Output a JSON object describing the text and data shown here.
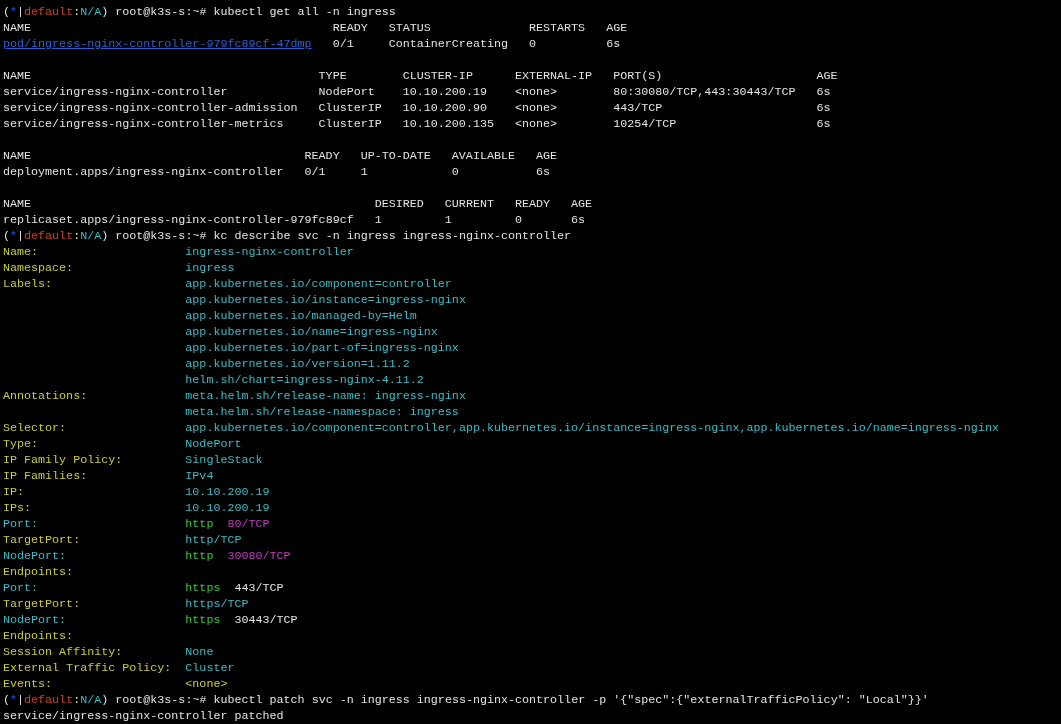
{
  "terminal": {
    "blocks": [
      {
        "kind": "prompt",
        "segments": [
          {
            "text": "(",
            "kind": "plain"
          },
          {
            "text": "*",
            "kind": "star"
          },
          {
            "text": "|",
            "kind": "plain"
          },
          {
            "text": "default",
            "kind": "context"
          },
          {
            "text": ":",
            "kind": "plain"
          },
          {
            "text": "N/A",
            "kind": "namespace"
          },
          {
            "text": ") root@k3s-s:~#",
            "kind": "plain"
          }
        ],
        "command": "kubectl get all -n ingress"
      },
      {
        "kind": "table",
        "header": [
          "NAME",
          "READY",
          "STATUS",
          "RESTARTS",
          "AGE"
        ],
        "rows": [
          {
            "linked": true,
            "cells": [
              "pod/ingress-nginx-controller-979fc89cf-47dmp",
              "0/1",
              "ContainerCreating",
              "0",
              "6s"
            ]
          }
        ]
      },
      {
        "kind": "table",
        "header": [
          "NAME",
          "TYPE",
          "CLUSTER-IP",
          "EXTERNAL-IP",
          "PORT(S)",
          "AGE"
        ],
        "rows": [
          {
            "linked": false,
            "cells": [
              "service/ingress-nginx-controller",
              "NodePort",
              "10.10.200.19",
              "<none>",
              "80:30080/TCP,443:30443/TCP",
              "6s"
            ]
          },
          {
            "linked": false,
            "cells": [
              "service/ingress-nginx-controller-admission",
              "ClusterIP",
              "10.10.200.90",
              "<none>",
              "443/TCP",
              "6s"
            ]
          },
          {
            "linked": false,
            "cells": [
              "service/ingress-nginx-controller-metrics",
              "ClusterIP",
              "10.10.200.135",
              "<none>",
              "10254/TCP",
              "6s"
            ]
          }
        ]
      },
      {
        "kind": "table",
        "header": [
          "NAME",
          "READY",
          "UP-TO-DATE",
          "AVAILABLE",
          "AGE"
        ],
        "rows": [
          {
            "linked": false,
            "cells": [
              "deployment.apps/ingress-nginx-controller",
              "0/1",
              "1",
              "0",
              "6s"
            ]
          }
        ]
      },
      {
        "kind": "table",
        "header": [
          "NAME",
          "DESIRED",
          "CURRENT",
          "READY",
          "AGE"
        ],
        "rows": [
          {
            "linked": false,
            "cells": [
              "replicaset.apps/ingress-nginx-controller-979fc89cf",
              "1",
              "1",
              "0",
              "6s"
            ]
          }
        ]
      },
      {
        "kind": "prompt",
        "segments": [
          {
            "text": "(",
            "kind": "plain"
          },
          {
            "text": "*",
            "kind": "star"
          },
          {
            "text": "|",
            "kind": "plain"
          },
          {
            "text": "default",
            "kind": "context"
          },
          {
            "text": ":",
            "kind": "plain"
          },
          {
            "text": "N/A",
            "kind": "namespace"
          },
          {
            "text": ") root@k3s-s:~#",
            "kind": "plain"
          }
        ],
        "command": "kc describe svc -n ingress ingress-nginx-controller"
      },
      {
        "kind": "describe",
        "rows": [
          {
            "key": "Name:",
            "kind": "field",
            "values": [
              {
                "text": "ingress-nginx-controller",
                "kind": "value"
              }
            ]
          },
          {
            "key": "Namespace:",
            "kind": "field",
            "values": [
              {
                "text": "ingress",
                "kind": "value"
              }
            ]
          },
          {
            "key": "Labels:",
            "kind": "field",
            "values": [
              {
                "text": "app.kubernetes.io/component=controller",
                "kind": "value"
              }
            ]
          },
          {
            "values": [
              {
                "text": "app.kubernetes.io/instance=ingress-nginx",
                "kind": "value"
              }
            ]
          },
          {
            "values": [
              {
                "text": "app.kubernetes.io/managed-by=Helm",
                "kind": "value"
              }
            ]
          },
          {
            "values": [
              {
                "text": "app.kubernetes.io/name=ingress-nginx",
                "kind": "value"
              }
            ]
          },
          {
            "values": [
              {
                "text": "app.kubernetes.io/part-of=ingress-nginx",
                "kind": "value"
              }
            ]
          },
          {
            "values": [
              {
                "text": "app.kubernetes.io/version=1.11.2",
                "kind": "value"
              }
            ]
          },
          {
            "values": [
              {
                "text": "helm.sh/chart=ingress-nginx-4.11.2",
                "kind": "value"
              }
            ]
          },
          {
            "key": "Annotations:",
            "kind": "field",
            "values": [
              {
                "text": "meta.helm.sh/release-name: ingress-nginx",
                "kind": "value"
              }
            ]
          },
          {
            "values": [
              {
                "text": "meta.helm.sh/release-namespace: ingress",
                "kind": "value"
              }
            ]
          },
          {
            "key": "Selector:",
            "kind": "field",
            "values": [
              {
                "text": "app.kubernetes.io/component=controller,app.kubernetes.io/instance=ingress-nginx,app.kubernetes.io/name=ingress-nginx",
                "kind": "value"
              }
            ]
          },
          {
            "key": "Type:",
            "kind": "field",
            "values": [
              {
                "text": "NodePort",
                "kind": "value"
              }
            ]
          },
          {
            "key": "IP Family Policy:",
            "kind": "field",
            "values": [
              {
                "text": "SingleStack",
                "kind": "value"
              }
            ]
          },
          {
            "key": "IP Families:",
            "kind": "field",
            "values": [
              {
                "text": "IPv4",
                "kind": "value"
              }
            ]
          },
          {
            "key": "IP:",
            "kind": "field",
            "values": [
              {
                "text": "10.10.200.19",
                "kind": "value"
              }
            ]
          },
          {
            "key": "IPs:",
            "kind": "field",
            "values": [
              {
                "text": "10.10.200.19",
                "kind": "value"
              }
            ]
          },
          {
            "key": "Port:",
            "kind": "port",
            "values": [
              {
                "text": "http",
                "kind": "port-name"
              },
              {
                "text": "80/TCP",
                "kind": "port-number"
              }
            ]
          },
          {
            "key": "TargetPort:",
            "kind": "field",
            "values": [
              {
                "text": "http/TCP",
                "kind": "value"
              }
            ]
          },
          {
            "key": "NodePort:",
            "kind": "port",
            "values": [
              {
                "text": "http",
                "kind": "port-name"
              },
              {
                "text": "30080/TCP",
                "kind": "port-number"
              }
            ]
          },
          {
            "key": "Endpoints:",
            "kind": "field"
          },
          {
            "key": "Port:",
            "kind": "port",
            "values": [
              {
                "text": "https",
                "kind": "port-name"
              },
              {
                "text": "443/TCP",
                "kind": "plain"
              }
            ]
          },
          {
            "key": "TargetPort:",
            "kind": "field",
            "values": [
              {
                "text": "https/TCP",
                "kind": "value"
              }
            ]
          },
          {
            "key": "NodePort:",
            "kind": "port",
            "values": [
              {
                "text": "https",
                "kind": "port-name"
              },
              {
                "text": "30443/TCP",
                "kind": "plain"
              }
            ]
          },
          {
            "key": "Endpoints:",
            "kind": "field"
          },
          {
            "key": "Session Affinity:",
            "kind": "field",
            "values": [
              {
                "text": "None",
                "kind": "value"
              }
            ]
          },
          {
            "key": "External Traffic Policy:",
            "kind": "field",
            "values": [
              {
                "text": "Cluster",
                "kind": "value"
              }
            ]
          },
          {
            "key": "Events:",
            "kind": "field",
            "values": [
              {
                "text": "<none>",
                "kind": "empty"
              }
            ]
          }
        ]
      },
      {
        "kind": "prompt",
        "segments": [
          {
            "text": "(",
            "kind": "plain"
          },
          {
            "text": "*",
            "kind": "star"
          },
          {
            "text": "|",
            "kind": "plain"
          },
          {
            "text": "default",
            "kind": "context"
          },
          {
            "text": ":",
            "kind": "plain"
          },
          {
            "text": "N/A",
            "kind": "namespace"
          },
          {
            "text": ") root@k3s-s:~#",
            "kind": "plain"
          }
        ],
        "command": "kubectl patch svc -n ingress ingress-nginx-controller -p '{\"spec\":{\"externalTrafficPolicy\": \"Local\"}}'"
      },
      {
        "kind": "output",
        "text": "service/ingress-nginx-controller patched"
      }
    ]
  }
}
